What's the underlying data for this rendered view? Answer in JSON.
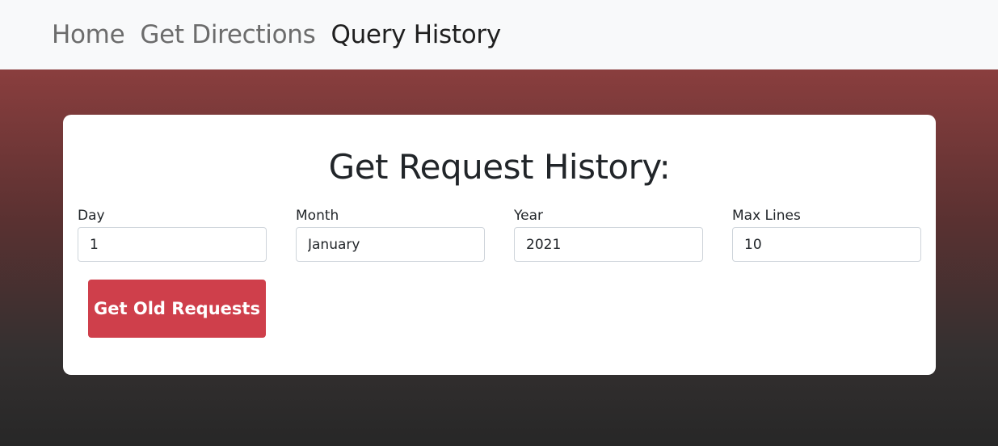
{
  "nav": {
    "items": [
      {
        "label": "Home"
      },
      {
        "label": "Get Directions"
      },
      {
        "label": "Query History"
      }
    ],
    "active_index": 2
  },
  "card": {
    "title": "Get Request History:",
    "fields": [
      {
        "label": "Day",
        "value": "1"
      },
      {
        "label": "Month",
        "value": "January"
      },
      {
        "label": "Year",
        "value": "2021"
      },
      {
        "label": "Max Lines",
        "value": "10"
      }
    ],
    "submit_label": "Get Old Requests"
  },
  "colors": {
    "navbar_bg": "#f8f9fa",
    "nav_inactive": "#6c6c6c",
    "nav_active": "#1f1f1f",
    "gradient_top": "#8a3e3e",
    "gradient_bottom": "#272727",
    "button_bg": "#cf3f4b",
    "button_text": "#ffffff"
  }
}
